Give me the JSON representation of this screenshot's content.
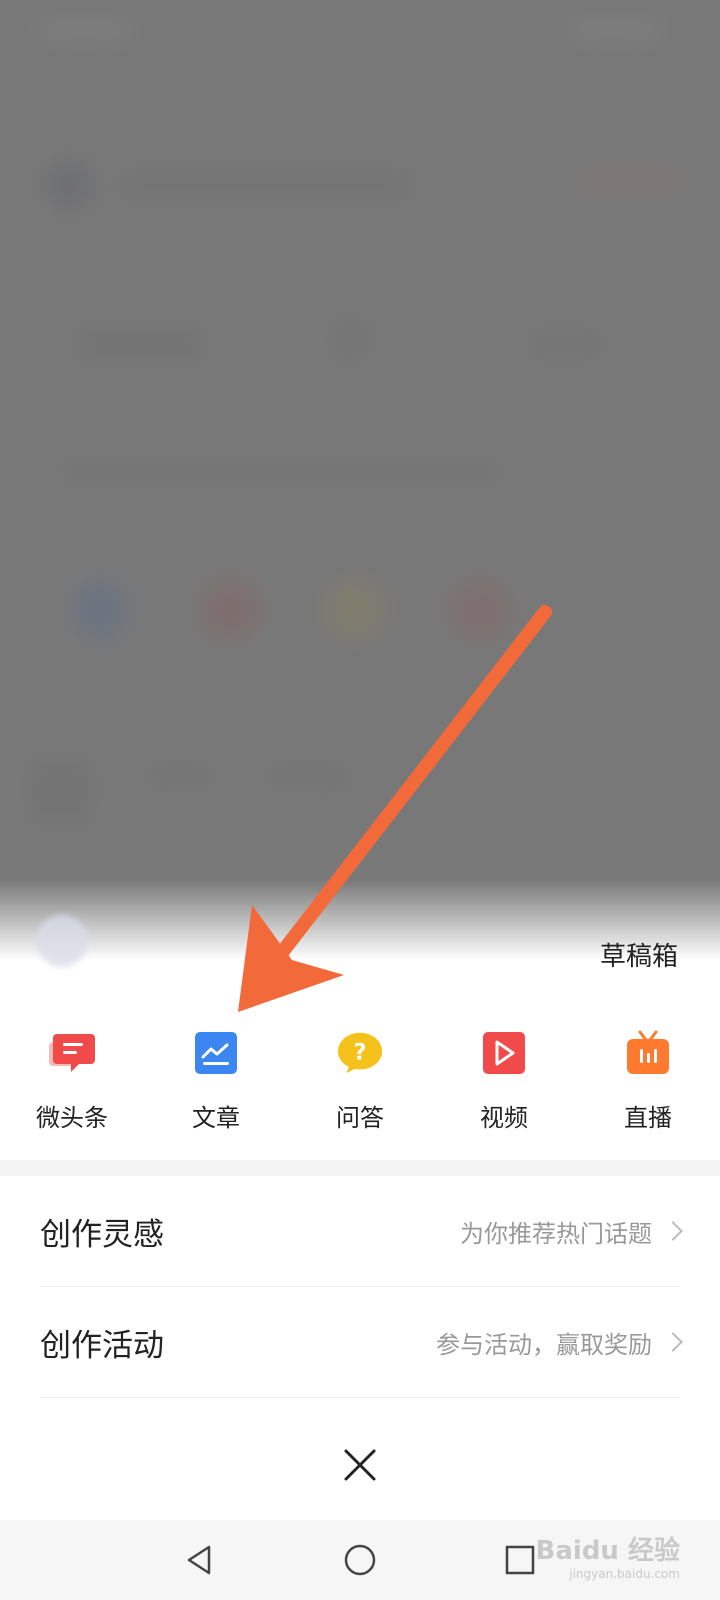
{
  "sheet": {
    "drafts_label": "草稿箱",
    "creators": [
      {
        "label": "微头条",
        "icon": "chat-bubble-icon",
        "color": "#f04a4a"
      },
      {
        "label": "文章",
        "icon": "article-icon",
        "color": "#3b86f0"
      },
      {
        "label": "问答",
        "icon": "question-icon",
        "color": "#f5c21b"
      },
      {
        "label": "视频",
        "icon": "video-play-icon",
        "color": "#f04a4a"
      },
      {
        "label": "直播",
        "icon": "live-tv-icon",
        "color": "#ff7a2f"
      }
    ],
    "rows": [
      {
        "title": "创作灵感",
        "hint": "为你推荐热门话题"
      },
      {
        "title": "创作活动",
        "hint": "参与活动，赢取奖励"
      }
    ]
  },
  "watermark": {
    "brand": "Baidu 经验",
    "url": "jingyan.baidu.com"
  },
  "colors": {
    "arrow": "#f26a3a"
  }
}
